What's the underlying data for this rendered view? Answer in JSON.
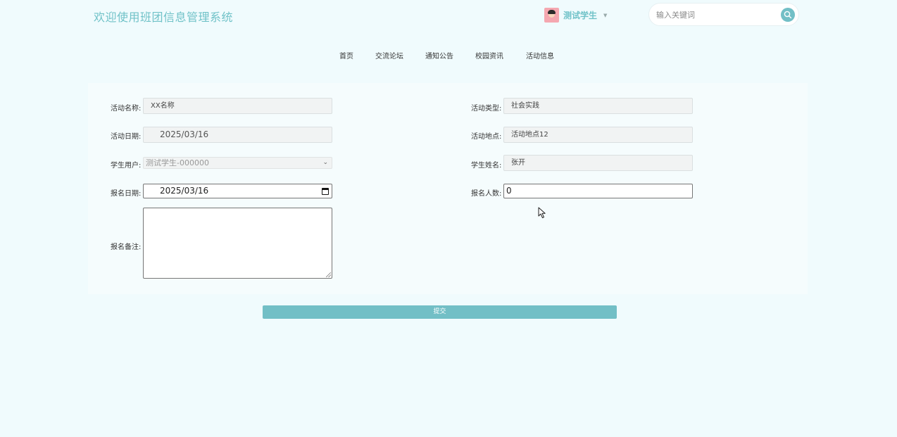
{
  "header": {
    "site_title": "欢迎使用班团信息管理系统",
    "username": "测试学生",
    "search_placeholder": "输入关键词"
  },
  "nav": {
    "items": [
      "首页",
      "交流论坛",
      "通知公告",
      "校园资讯",
      "活动信息"
    ]
  },
  "form": {
    "activity_name": {
      "label": "活动名称:",
      "value": "XX名称"
    },
    "activity_type": {
      "label": "活动类型:",
      "value": "社会实践"
    },
    "activity_date": {
      "label": "活动日期:",
      "value": "2025/03/16"
    },
    "activity_location": {
      "label": "活动地点:",
      "value": "活动地点12"
    },
    "student_user": {
      "label": "学生用户:",
      "value": "测试学生-000000"
    },
    "student_name": {
      "label": "学生姓名:",
      "value": "张开"
    },
    "signup_date": {
      "label": "报名日期:",
      "value": "2025/03/16"
    },
    "signup_count": {
      "label": "报名人数:",
      "value": "0"
    },
    "signup_notes": {
      "label": "报名备注:",
      "value": ""
    },
    "submit_label": "提交"
  },
  "colors": {
    "accent": "#72bfc6",
    "title": "#70c2c8",
    "background": "#f0fbfd"
  }
}
